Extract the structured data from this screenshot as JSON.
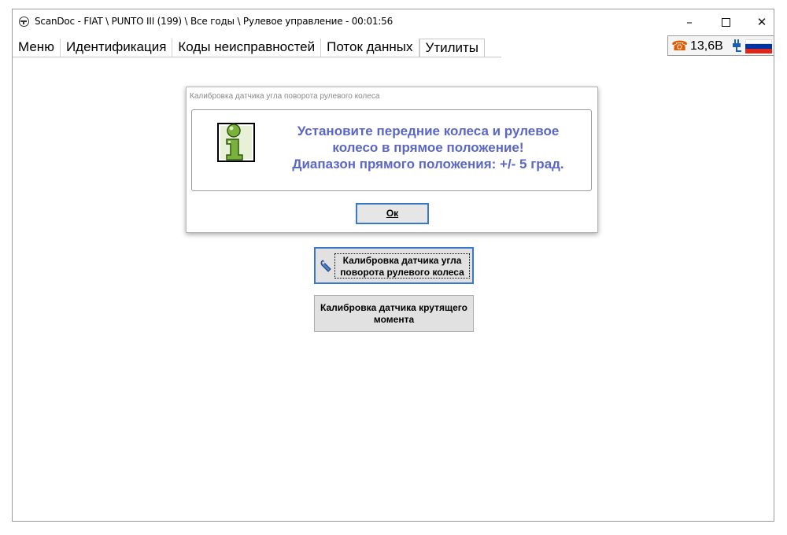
{
  "window": {
    "title": "ScanDoc - FIAT \\ PUNTO III (199) \\ Все годы \\ Рулевое управление - 00:01:56",
    "icon": "steering-wheel-icon",
    "controls": {
      "minimize": "–",
      "maximize": "max-box",
      "close": "✕"
    }
  },
  "menu": {
    "tabs": [
      {
        "label": "Меню"
      },
      {
        "label": "Идентификация"
      },
      {
        "label": "Коды неисправностей"
      },
      {
        "label": "Поток данных"
      },
      {
        "label": "Утилиты",
        "active": true
      }
    ]
  },
  "status": {
    "phone_icon": "phone-icon",
    "voltage": "13,6В",
    "plug_icon": "plug-icon",
    "flag_colors": [
      "#ffffff",
      "#0032a0",
      "#da291c"
    ]
  },
  "dialog": {
    "title": "Калибровка датчика угла поворота рулевого колеса",
    "message_lines": [
      "Установите передние колеса и рулевое",
      "колесо в прямое положение!",
      "Диапазон прямого положения: +/- 5 град."
    ],
    "icon": "info-icon",
    "ok_label": "Ок"
  },
  "utilities": {
    "buttons": [
      {
        "line1": "Калибровка датчика угла",
        "line2": "поворота рулевого колеса",
        "icon": "wrench-icon",
        "focused": true
      },
      {
        "line1": "Калибровка датчика крутящего",
        "line2": "момента"
      }
    ]
  },
  "colors": {
    "message_text": "#5b67c6",
    "focus_border": "#3a78c8",
    "phone_icon": "#e05a00"
  }
}
